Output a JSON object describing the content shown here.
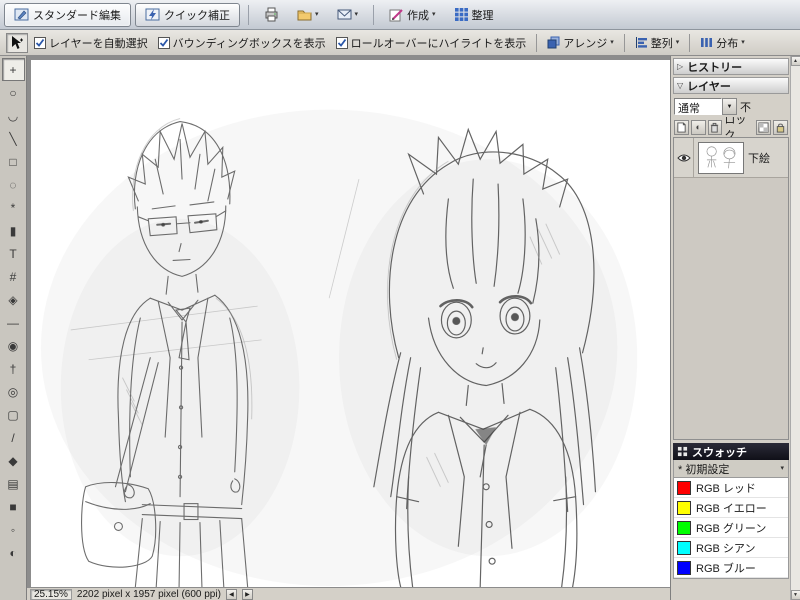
{
  "icons": {
    "collapsed": "▷",
    "expanded": "▽",
    "dropdown_arrow": "▼",
    "small_caret": "▾",
    "left_arrow": "◀",
    "right_arrow": "▶",
    "up_arrow": "▲",
    "down_arrow": "▼",
    "adjustment_layer": "◐"
  },
  "shortcuts_bar": {
    "tabs": [
      {
        "label": "スタンダード編集",
        "active": true
      },
      {
        "label": "クイック補正",
        "active": false
      }
    ],
    "create_label": "作成",
    "organize_label": "整理"
  },
  "options_bar": {
    "checkboxes": [
      {
        "label": "レイヤーを自動選択",
        "checked": true
      },
      {
        "label": "バウンディングボックスを表示",
        "checked": true
      },
      {
        "label": "ロールオーバーにハイライトを表示",
        "checked": true
      }
    ],
    "arrange_label": "アレンジ",
    "align_label": "整列",
    "distribute_label": "分布"
  },
  "toolbox": {
    "tools": [
      {
        "name": "move-tool",
        "glyph": "+",
        "selected": true
      },
      {
        "name": "zoom-tool",
        "glyph": "○",
        "selected": false
      },
      {
        "name": "hand-tool",
        "glyph": "◡",
        "selected": false
      },
      {
        "name": "eyedropper-tool",
        "glyph": "╲",
        "selected": false
      },
      {
        "name": "marquee-tool",
        "glyph": "□",
        "selected": false
      },
      {
        "name": "lasso-tool",
        "glyph": "◌",
        "selected": false
      },
      {
        "name": "magic-wand-tool",
        "glyph": "*",
        "selected": false
      },
      {
        "name": "selection-brush-tool",
        "glyph": "▮",
        "selected": false
      },
      {
        "name": "type-tool",
        "glyph": "T",
        "selected": false
      },
      {
        "name": "crop-tool",
        "glyph": "#",
        "selected": false
      },
      {
        "name": "cookie-cutter-tool",
        "glyph": "◈",
        "selected": false
      },
      {
        "name": "straighten-tool",
        "glyph": "—",
        "selected": false
      },
      {
        "name": "red-eye-removal-tool",
        "glyph": "◉",
        "selected": false
      },
      {
        "name": "healing-brush-tool",
        "glyph": "†",
        "selected": false
      },
      {
        "name": "clone-stamp-tool",
        "glyph": "◎",
        "selected": false
      },
      {
        "name": "eraser-tool",
        "glyph": "▢",
        "selected": false
      },
      {
        "name": "brush-tool",
        "glyph": "/",
        "selected": false
      },
      {
        "name": "paint-bucket-tool",
        "glyph": "◆",
        "selected": false
      },
      {
        "name": "gradient-tool",
        "glyph": "▤",
        "selected": false
      },
      {
        "name": "shape-tool",
        "glyph": "■",
        "selected": false
      },
      {
        "name": "blur-tool",
        "glyph": "◦",
        "selected": false
      },
      {
        "name": "sponge-tool",
        "glyph": "◐",
        "selected": false
      }
    ]
  },
  "canvas": {
    "description": "二人のキャラクターの鉛筆下描きスケッチ（制服の少年と長髪の少女）"
  },
  "palettes": {
    "history": {
      "title": "ヒストリー"
    },
    "layers": {
      "title": "レイヤー",
      "blend_mode": "通常",
      "opacity_label_clipped": "不",
      "lock_label": "ロック",
      "layers": [
        {
          "name": "下絵",
          "visible": true
        }
      ]
    },
    "swatches": {
      "title": "スウォッチ",
      "preset": "* 初期設定",
      "items": [
        {
          "name": "RGB レッド",
          "color": "#ff0000"
        },
        {
          "name": "RGB イエロー",
          "color": "#ffff00"
        },
        {
          "name": "RGB グリーン",
          "color": "#00ff00"
        },
        {
          "name": "RGB シアン",
          "color": "#00ffff"
        },
        {
          "name": "RGB ブルー",
          "color": "#0000ff"
        }
      ]
    }
  },
  "status_bar": {
    "zoom": "25.15%",
    "doc_info": "2202 pixel x 1957 pixel (600 ppi)"
  }
}
